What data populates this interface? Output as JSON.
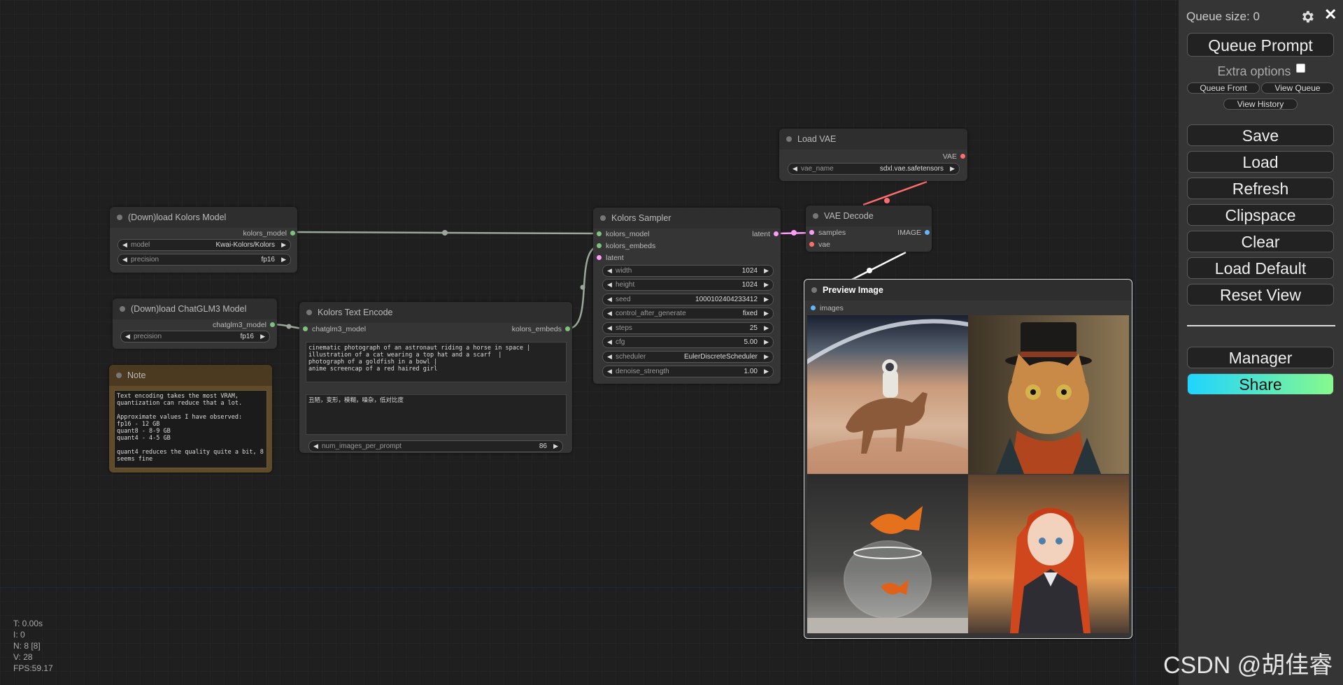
{
  "colors": {
    "canvas_bg": "#1f1f1f",
    "node_bg": "#353535",
    "note_bg": "#4b3a1f",
    "model_slot": "#7fc27f",
    "latent_slot": "#ff9cf9",
    "vae_slot": "#ff6e6e",
    "image_slot": "#64b5f6",
    "share_gradient_start": "#1fd4ff",
    "share_gradient_end": "#87f98d"
  },
  "nodes": {
    "load_kolors": {
      "title": "(Down)load Kolors Model",
      "output": "kolors_model",
      "widgets": [
        {
          "label": "model",
          "value": "Kwai-Kolors/Kolors"
        },
        {
          "label": "precision",
          "value": "fp16"
        }
      ]
    },
    "load_chatglm": {
      "title": "(Down)load ChatGLM3 Model",
      "output": "chatglm3_model",
      "widgets": [
        {
          "label": "precision",
          "value": "fp16"
        }
      ]
    },
    "note": {
      "title": "Note",
      "text": "Text encoding takes the most VRAM, quantization can reduce that a lot.\n\nApproximate values I have observed:\nfp16 - 12 GB\nquant8 - 8-9 GB\nquant4 - 4-5 GB\n\nquant4 reduces the quality quite a bit, 8 seems fine"
    },
    "text_encode": {
      "title": "Kolors Text Encode",
      "input": "chatglm3_model",
      "output": "kolors_embeds",
      "prompt": "cinematic photograph of an astronaut riding a horse in space |\nillustration of a cat wearing a top hat and a scarf  |\nphotograph of a goldfish in a bowl |\nanime screencap of a red haired girl",
      "negative": "丑陋，变形，模糊，噪杂，低对比度",
      "widget": {
        "label": "num_images_per_prompt",
        "value": "86"
      }
    },
    "sampler": {
      "title": "Kolors Sampler",
      "inputs": [
        "kolors_model",
        "kolors_embeds",
        "latent"
      ],
      "output": "latent",
      "widgets": [
        {
          "label": "width",
          "value": "1024"
        },
        {
          "label": "height",
          "value": "1024"
        },
        {
          "label": "seed",
          "value": "1000102404233412"
        },
        {
          "label": "control_after_generate",
          "value": "fixed"
        },
        {
          "label": "steps",
          "value": "25"
        },
        {
          "label": "cfg",
          "value": "5.00"
        },
        {
          "label": "scheduler",
          "value": "EulerDiscreteScheduler"
        },
        {
          "label": "denoise_strength",
          "value": "1.00"
        }
      ]
    },
    "load_vae": {
      "title": "Load VAE",
      "output": "VAE",
      "widget": {
        "label": "vae_name",
        "value": "sdxl.vae.safetensors"
      }
    },
    "vae_decode": {
      "title": "VAE Decode",
      "inputs": [
        "samples",
        "vae"
      ],
      "output": "IMAGE"
    },
    "preview": {
      "title": "Preview Image",
      "input": "images"
    }
  },
  "menu": {
    "queue_size": "Queue size: 0",
    "queue_prompt": "Queue Prompt",
    "extra_options": "Extra options",
    "queue_front": "Queue Front",
    "view_queue": "View Queue",
    "view_history": "View History",
    "save": "Save",
    "load": "Load",
    "refresh": "Refresh",
    "clipspace": "Clipspace",
    "clear": "Clear",
    "load_default": "Load Default",
    "reset_view": "Reset View",
    "manager": "Manager",
    "share": "Share"
  },
  "stats": {
    "t": "T: 0.00s",
    "i": "I: 0",
    "n": "N: 8 [8]",
    "v": "V: 28",
    "fps": "FPS:59.17"
  },
  "watermark": "CSDN @胡佳睿"
}
